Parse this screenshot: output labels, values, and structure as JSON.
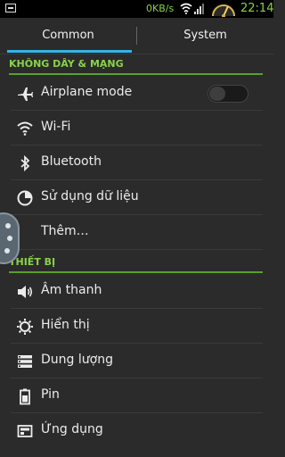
{
  "status_bar": {
    "network_speed": "0KB/s",
    "time": "22:14"
  },
  "tabs": [
    {
      "label": "Common",
      "selected": true
    },
    {
      "label": "System",
      "selected": false
    }
  ],
  "sections": [
    {
      "header": "KHÔNG DÂY & MẠNG",
      "items": [
        {
          "label": "Airplane mode",
          "icon": "airplane-icon",
          "toggle": "off"
        },
        {
          "label": "Wi-Fi",
          "icon": "wifi-icon"
        },
        {
          "label": "Bluetooth",
          "icon": "bluetooth-icon"
        },
        {
          "label": "Sử dụng dữ liệu",
          "icon": "data-usage-icon"
        },
        {
          "label": "Thêm…",
          "icon": ""
        }
      ]
    },
    {
      "header": "THIẾT BỊ",
      "items": [
        {
          "label": "Âm thanh",
          "icon": "speaker-icon"
        },
        {
          "label": "Hiển thị",
          "icon": "brightness-icon"
        },
        {
          "label": "Dung lượng",
          "icon": "storage-icon"
        },
        {
          "label": "Pin",
          "icon": "battery-icon"
        },
        {
          "label": "Ứng dụng",
          "icon": "apps-icon"
        }
      ]
    }
  ],
  "colors": {
    "accent_blue": "#33b5e5",
    "section_green": "#8ad24a",
    "background": "#2b2b2b"
  }
}
